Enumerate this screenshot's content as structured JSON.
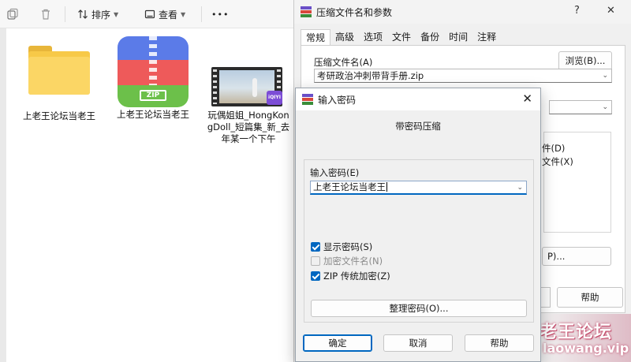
{
  "explorer": {
    "toolbar": {
      "sort_label": "排序",
      "view_label": "查看",
      "more_label": "•••"
    },
    "files": [
      {
        "name": "上老王论坛当老王",
        "type": "folder"
      },
      {
        "name": "上老王论坛当老王",
        "type": "zip",
        "icon_text": "ZIP"
      },
      {
        "name": "玩偶姐姐_HongKongDoll_短篇集_新_去年某一个下午",
        "type": "video",
        "badge": "iQIYI"
      }
    ]
  },
  "main_dialog": {
    "title": "压缩文件名和参数",
    "title_controls": {
      "help": "?",
      "close": "✕"
    },
    "tabs": [
      "常规",
      "高级",
      "选项",
      "文件",
      "备份",
      "时间",
      "注释"
    ],
    "active_tab": "常规",
    "archive_name_label": "压缩文件名(A)",
    "browse_button": "浏览(B)...",
    "archive_name_value": "考研政治冲刺带背手册.zip",
    "partial_option_1": "件(D)",
    "partial_option_2": "文件(X)",
    "partial_button": "P)...",
    "help_button": "帮助"
  },
  "password_dialog": {
    "title": "输入密码",
    "close": "✕",
    "subtitle": "带密码压缩",
    "password_label": "输入密码(E)",
    "password_value": "上老王论坛当老王",
    "options": [
      {
        "label": "显示密码(S)",
        "checked": true,
        "enabled": true
      },
      {
        "label": "加密文件名(N)",
        "checked": false,
        "enabled": false
      },
      {
        "label": "ZIP 传统加密(Z)",
        "checked": true,
        "enabled": true
      }
    ],
    "organize_button": "整理密码(O)...",
    "ok_button": "确定",
    "cancel_button": "取消",
    "help_button": "帮助"
  },
  "watermark": {
    "line1": "老王论坛",
    "line2": "laowang.vip"
  },
  "colors": {
    "accent": "#0067c0",
    "dialog_bg": "#f0f0f0"
  }
}
